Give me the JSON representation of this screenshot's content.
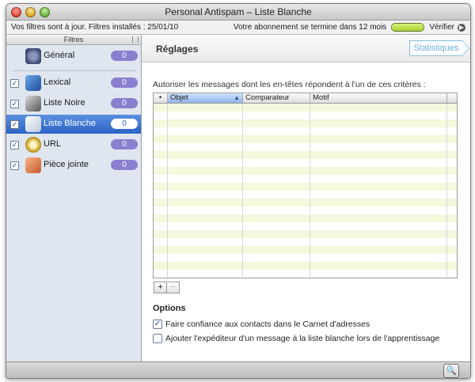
{
  "window": {
    "title": "Personal Antispam – Liste Blanche"
  },
  "status": {
    "left_text": "Vos filtres sont à jour. Filtres installés : 25/01/10",
    "subscription_text": "Votre abonnement se termine dans 12 mois",
    "subscription_level": 1.0,
    "verify_label": "Vérifier"
  },
  "sidebar": {
    "header": "Filtres",
    "items": [
      {
        "label": "Général",
        "checked": false,
        "selected": false,
        "icon": "gear-icon",
        "badge": "0"
      },
      {
        "label": "Lexical",
        "checked": true,
        "selected": false,
        "icon": "lexical-icon",
        "badge": "0"
      },
      {
        "label": "Liste Noire",
        "checked": true,
        "selected": false,
        "icon": "blacklist-icon",
        "badge": "0"
      },
      {
        "label": "Liste Blanche",
        "checked": true,
        "selected": true,
        "icon": "whitelist-icon",
        "badge": "0"
      },
      {
        "label": "URL",
        "checked": true,
        "selected": false,
        "icon": "url-icon",
        "badge": "0"
      },
      {
        "label": "Pièce jointe",
        "checked": true,
        "selected": false,
        "icon": "attachment-icon",
        "badge": "0"
      }
    ]
  },
  "main": {
    "title": "Réglages",
    "statistics_button": "Statistiques",
    "description": "Autoriser les messages dont les en-têtes répondent à l'un de ces critères :",
    "table": {
      "columns": [
        "•",
        "Objet",
        "Comparateur",
        "Motif"
      ],
      "sorted_column": "Objet",
      "rows": []
    },
    "add_label": "+",
    "remove_label": "−",
    "options_title": "Options",
    "options": [
      {
        "label": "Faire confiance aux contacts dans le Carnet d'adresses",
        "checked": true
      },
      {
        "label": "Ajouter l'expéditeur d'un message à la liste blanche lors de l'apprentissage",
        "checked": false
      }
    ]
  },
  "colors": {
    "selection": "#2b63c6",
    "badge": "#8b7fcf",
    "row_stripe": "#f3f9dd",
    "statistics_accent": "#7ab2d6"
  }
}
